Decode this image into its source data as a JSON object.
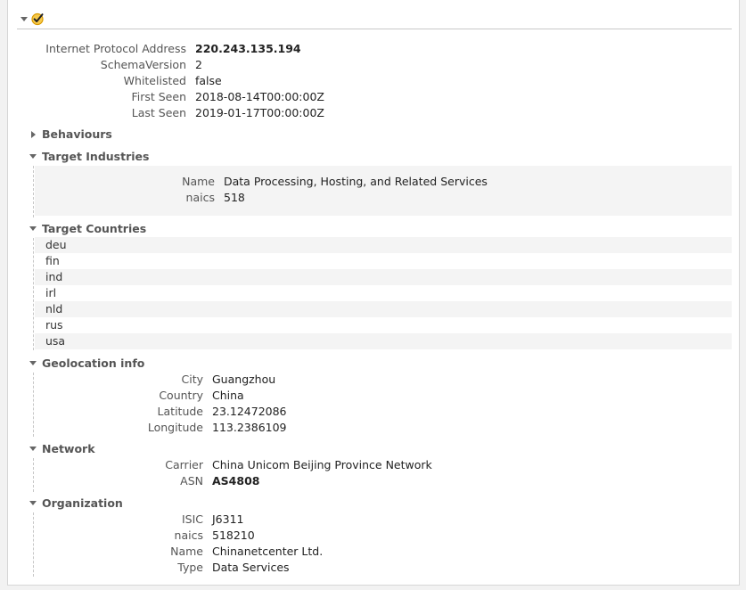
{
  "root": {
    "fields": [
      {
        "key": "Internet Protocol Address",
        "value": "220.243.135.194",
        "bold": true
      },
      {
        "key": "SchemaVersion",
        "value": "2"
      },
      {
        "key": "Whitelisted",
        "value": "false"
      },
      {
        "key": "First Seen",
        "value": "2018-08-14T00:00:00Z"
      },
      {
        "key": "Last Seen",
        "value": "2019-01-17T00:00:00Z"
      }
    ]
  },
  "sections": {
    "behaviours": {
      "title": "Behaviours"
    },
    "target_industries": {
      "title": "Target Industries",
      "fields": [
        {
          "key": "Name",
          "value": "Data Processing, Hosting, and Related Services"
        },
        {
          "key": "naics",
          "value": "518"
        }
      ]
    },
    "target_countries": {
      "title": "Target Countries",
      "items": [
        "deu",
        "fin",
        "ind",
        "irl",
        "nld",
        "rus",
        "usa"
      ]
    },
    "geolocation": {
      "title": "Geolocation info",
      "fields": [
        {
          "key": "City",
          "value": "Guangzhou"
        },
        {
          "key": "Country",
          "value": "China"
        },
        {
          "key": "Latitude",
          "value": "23.12472086"
        },
        {
          "key": "Longitude",
          "value": "113.2386109"
        }
      ]
    },
    "network": {
      "title": "Network",
      "fields": [
        {
          "key": "Carrier",
          "value": "China Unicom Beijing Province Network"
        },
        {
          "key": "ASN",
          "value": "AS4808",
          "bold": true
        }
      ]
    },
    "organization": {
      "title": "Organization",
      "fields": [
        {
          "key": "ISIC",
          "value": "J6311"
        },
        {
          "key": "naics",
          "value": "518210"
        },
        {
          "key": "Name",
          "value": "Chinanetcenter Ltd."
        },
        {
          "key": "Type",
          "value": "Data Services"
        }
      ]
    }
  },
  "icons": {
    "status": "check-circle-icon",
    "status_color": "#f5a800"
  }
}
